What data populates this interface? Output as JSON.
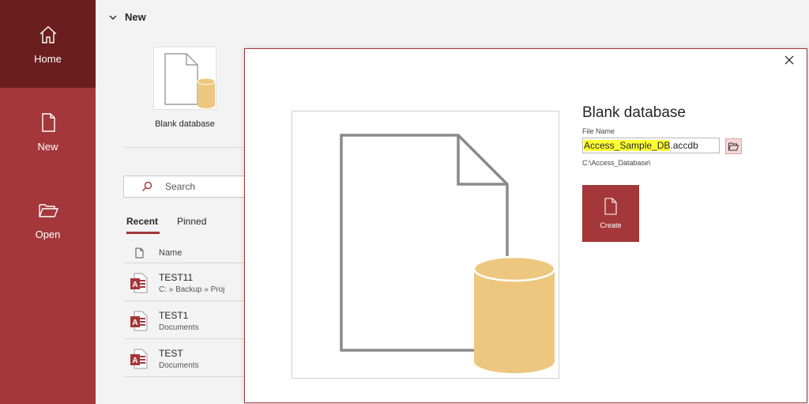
{
  "sidebar": {
    "items": [
      {
        "label": "Home",
        "icon": "home-icon"
      },
      {
        "label": "New",
        "icon": "new-document-icon"
      },
      {
        "label": "Open",
        "icon": "folder-open-icon"
      }
    ]
  },
  "main": {
    "section_title": "New",
    "template": {
      "label": "Blank database"
    },
    "search": {
      "placeholder": "Search"
    },
    "tabs": [
      {
        "label": "Recent"
      },
      {
        "label": "Pinned"
      }
    ],
    "list_header": {
      "name": "Name"
    },
    "files": [
      {
        "name": "TEST11",
        "path": "C: » Backup » Proj"
      },
      {
        "name": "TEST1",
        "path": "Documents"
      },
      {
        "name": "TEST",
        "path": "Documents"
      }
    ]
  },
  "dialog": {
    "title": "Blank database",
    "file_name_label": "File Name",
    "file_name_highlighted": "Access_Sample_DB",
    "file_name_extension": ".accdb",
    "save_path": "C:\\Access_Database\\",
    "create_label": "Create"
  },
  "colors": {
    "accent": "#a4373a",
    "accent_dark": "#6b1e1e",
    "highlight": "#ffff33",
    "database_fill": "#edc77f"
  }
}
